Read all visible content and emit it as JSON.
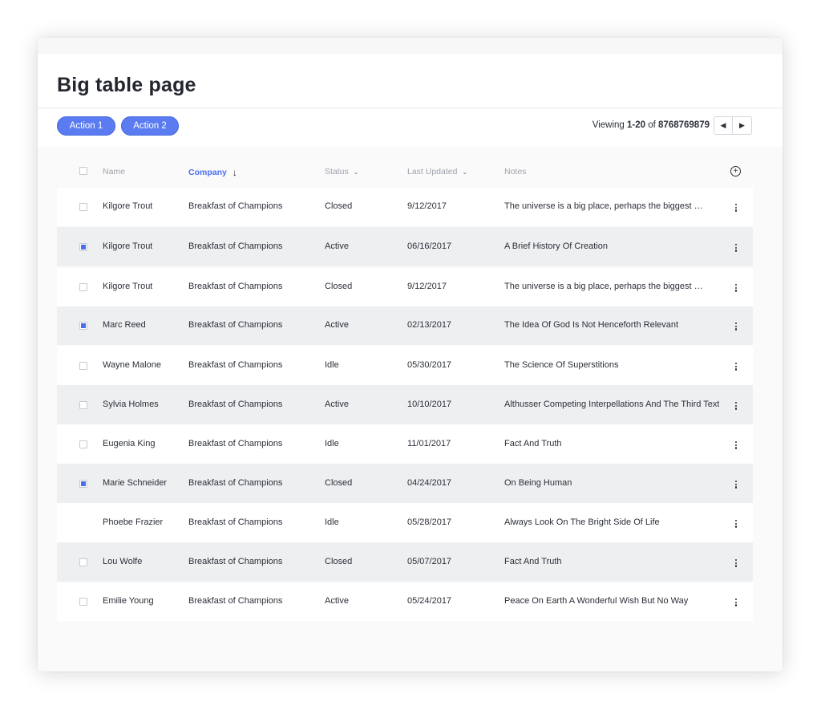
{
  "page": {
    "title": "Big table page"
  },
  "toolbar": {
    "actions": [
      "Action 1",
      "Action 2"
    ],
    "viewing": {
      "prefix": "Viewing ",
      "range": "1-20",
      "of": " of ",
      "total": "8768769879"
    }
  },
  "table": {
    "columns": {
      "name": "Name",
      "company": "Company",
      "status": "Status",
      "last_updated": "Last Updated",
      "notes": "Notes"
    },
    "sorted_by": "company",
    "sort_direction": "descending",
    "rows": [
      {
        "name": "Kilgore Trout",
        "company": "Breakfast of Champions",
        "status": "Closed",
        "updated": "9/12/2017",
        "notes": "The universe is a big place, perhaps the biggest …",
        "checked": false,
        "shaded": false
      },
      {
        "name": "Kilgore Trout",
        "company": "Breakfast of Champions",
        "status": "Active",
        "updated": "06/16/2017",
        "notes": "A Brief History Of Creation",
        "checked": true,
        "shaded": true
      },
      {
        "name": "Kilgore Trout",
        "company": "Breakfast of Champions",
        "status": "Closed",
        "updated": "9/12/2017",
        "notes": "The universe is a big place, perhaps the biggest …",
        "checked": false,
        "shaded": false
      },
      {
        "name": "Marc Reed",
        "company": "Breakfast of Champions",
        "status": "Active",
        "updated": "02/13/2017",
        "notes": "The Idea Of God Is Not Henceforth Relevant",
        "checked": true,
        "shaded": true
      },
      {
        "name": "Wayne Malone",
        "company": "Breakfast of Champions",
        "status": "Idle",
        "updated": "05/30/2017",
        "notes": "The Science Of Superstitions",
        "checked": false,
        "shaded": false
      },
      {
        "name": "Sylvia Holmes",
        "company": "Breakfast of Champions",
        "status": "Active",
        "updated": "10/10/2017",
        "notes": "Althusser Competing Interpellations And The Third Text",
        "checked": false,
        "shaded": true
      },
      {
        "name": "Eugenia King",
        "company": "Breakfast of Champions",
        "status": "Idle",
        "updated": "11/01/2017",
        "notes": "Fact And Truth",
        "checked": false,
        "shaded": false
      },
      {
        "name": "Marie Schneider",
        "company": "Breakfast of Champions",
        "status": "Closed",
        "updated": "04/24/2017",
        "notes": "On Being Human",
        "checked": true,
        "shaded": true
      },
      {
        "name": "Phoebe Frazier",
        "company": "Breakfast of Champions",
        "status": "Idle",
        "updated": "05/28/2017",
        "notes": "Always Look On The Bright Side Of Life",
        "checked": false,
        "shaded": false,
        "no_checkbox": true
      },
      {
        "name": "Lou Wolfe",
        "company": "Breakfast of Champions",
        "status": "Closed",
        "updated": "05/07/2017",
        "notes": "Fact And Truth",
        "checked": false,
        "shaded": true
      },
      {
        "name": "Emilie Young",
        "company": "Breakfast of Champions",
        "status": "Active",
        "updated": "05/24/2017",
        "notes": "Peace On Earth A Wonderful Wish But No Way",
        "checked": false,
        "shaded": false
      }
    ]
  },
  "icons": {
    "sort": "arrow-down-icon",
    "column_caret": "chevron-down-icon",
    "add_column": "plus-circle-icon",
    "row_menu": "kebab-icon",
    "prev": "chevron-left-icon",
    "next": "chevron-right-icon"
  },
  "colors": {
    "accent": "#5b7cf0",
    "sorted_header": "#4a6ef0",
    "row_shade": "#eeeff1"
  }
}
